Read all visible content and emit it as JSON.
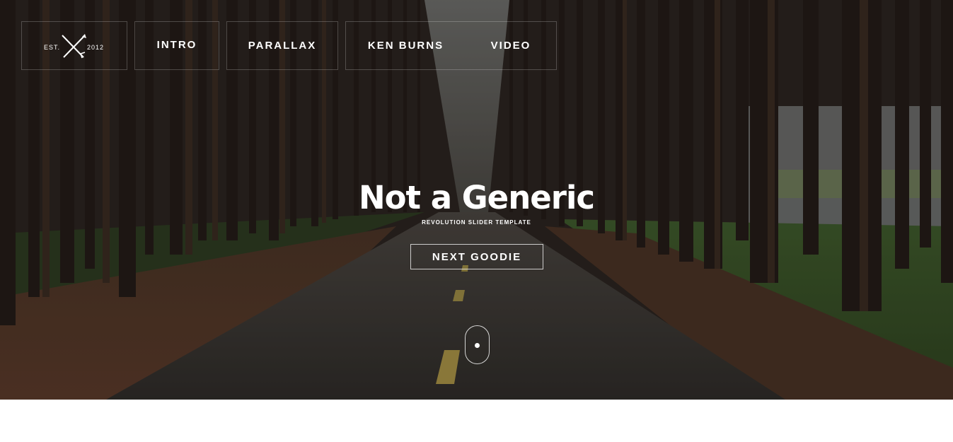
{
  "logo": {
    "est_label": "EST.",
    "year": "2012",
    "icon": "crossed-arrows-icon"
  },
  "nav": {
    "items": [
      {
        "label": "INTRO"
      },
      {
        "label": "PARALLAX"
      },
      {
        "label": "KEN BURNS"
      },
      {
        "label": "VIDEO"
      }
    ]
  },
  "hero": {
    "title": "Not a Generic",
    "subtitle": "REVOLUTION SLIDER TEMPLATE",
    "cta_label": "NEXT GOODIE",
    "scroll_icon": "mouse-scroll-icon"
  },
  "colors": {
    "text": "#ffffff",
    "page_bg": "#ffffff"
  }
}
